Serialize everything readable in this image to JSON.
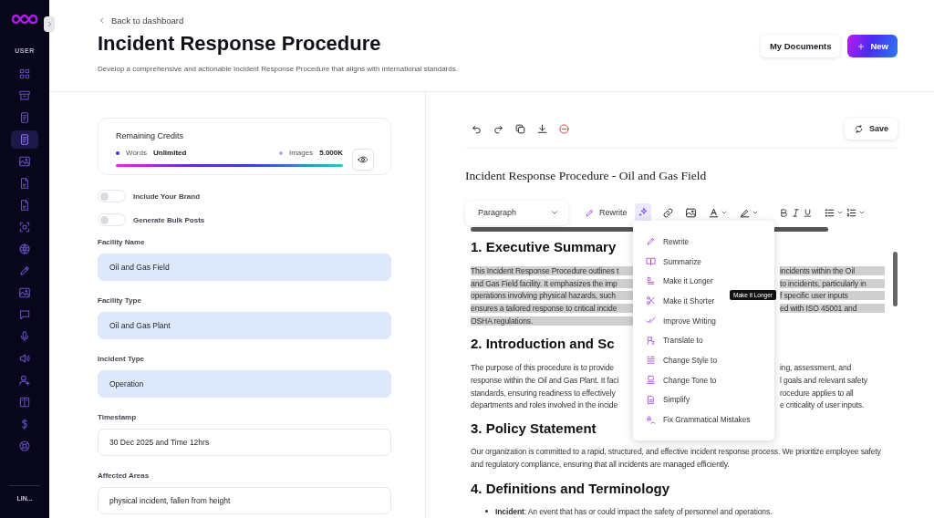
{
  "sidebar": {
    "section_label": "USER",
    "items": [
      {
        "selected": false
      },
      {
        "selected": false
      },
      {
        "selected": false
      },
      {
        "selected": true
      },
      {
        "selected": false
      },
      {
        "selected": false
      },
      {
        "selected": false
      },
      {
        "selected": false
      },
      {
        "selected": false
      },
      {
        "selected": false
      },
      {
        "selected": false
      },
      {
        "selected": false
      },
      {
        "selected": false
      },
      {
        "selected": false
      },
      {
        "selected": false
      },
      {
        "selected": false
      },
      {
        "selected": false
      },
      {
        "selected": false
      }
    ],
    "footer_label": "LIN..."
  },
  "header": {
    "back_link": "Back to dashboard",
    "title": "Incident Response Procedure",
    "subtitle": "Develop a comprehensive and actionable Incident Response Procedure that aligns with international standards.",
    "buttons": [
      {
        "label": "My Documents",
        "kind": "secondary"
      },
      {
        "label": "New",
        "kind": "primary"
      }
    ]
  },
  "form": {
    "credits": {
      "title": "Remaining Credits",
      "words_label": "Words",
      "words_value": "Unlimited",
      "images_label": "Images",
      "images_value": "5.000K",
      "level": 1
    },
    "toggles": [
      {
        "label": "Include Your Brand",
        "on": false
      },
      {
        "label": "Generate Bulk Posts",
        "on": false
      }
    ],
    "fields": [
      {
        "label": "Facility Name",
        "value": "Oil and Gas Field",
        "autofilled": true
      },
      {
        "label": "Facility Type",
        "value": "Oil and Gas Plant",
        "autofilled": true
      },
      {
        "label": "Incident Type",
        "value": "Operation",
        "autofilled": true
      },
      {
        "label": "Timestamp",
        "value": "30 Dec 2025 and Time 12hrs",
        "autofilled": false
      },
      {
        "label": "Affected Areas",
        "value": "physical incident, fallen from height",
        "autofilled": false
      }
    ]
  },
  "editor": {
    "save_label": "Save",
    "document_title": "Incident Response Procedure - Oil and Gas Field",
    "block_format": "Paragraph",
    "rewrite_label": "Rewrite",
    "blocks": [
      {
        "kind": "heading",
        "text": "1. Executive Summary"
      },
      {
        "kind": "split_paragraph",
        "highlighted": true,
        "lines": [
          {
            "left": "This Incident Response Procedure outlines t",
            "right": "incidents within the Oil"
          },
          {
            "left": "and Gas Field facility. It emphasizes the imp",
            "right": "to incidents, particularly in"
          },
          {
            "left": "operations involving physical hazards, such",
            "right": "f specific user inputs"
          },
          {
            "left": "ensures a tailored response to critical incide",
            "right": "ed with ISO 45001 and"
          },
          {
            "left": "OSHA regulations."
          }
        ]
      },
      {
        "kind": "heading",
        "text": "2. Introduction and Sc"
      },
      {
        "kind": "split_paragraph",
        "highlighted": false,
        "lines": [
          {
            "left": "The purpose of this procedure is to provide",
            "right": "ing, assessment, and"
          },
          {
            "left": "response within the Oil and Gas Plant. It faci",
            "right": "l goals and relevant safety"
          },
          {
            "left": "standards, ensuring readiness to effectively",
            "right": "rocedure applies to all"
          },
          {
            "left": "departments and roles involved in the incide",
            "right": "e criticality of user inputs."
          }
        ]
      },
      {
        "kind": "heading",
        "text": "3. Policy Statement"
      },
      {
        "kind": "paragraph",
        "text": "Our organization is committed to a rapid, structured, and effective incident response process. We prioritize employee safety and regulatory compliance, ensuring that all incidents are managed efficiently."
      },
      {
        "kind": "heading",
        "text": "4. Definitions and Terminology"
      },
      {
        "kind": "bullets",
        "items": [
          "**Incident**: An event that has or could impact the safety of personnel and operations."
        ]
      }
    ],
    "ai_menu": [
      {
        "label": "Rewrite"
      },
      {
        "label": "Summarize"
      },
      {
        "label": "Make it Longer"
      },
      {
        "label": "Make it Shorter"
      },
      {
        "label": "Improve Writing"
      },
      {
        "label": "Translate to"
      },
      {
        "label": "Change Style to"
      },
      {
        "label": "Change Tone to"
      },
      {
        "label": "Simplify"
      },
      {
        "label": "Fix Grammatical Mistakes"
      }
    ],
    "tooltip": "Make it Longer"
  }
}
